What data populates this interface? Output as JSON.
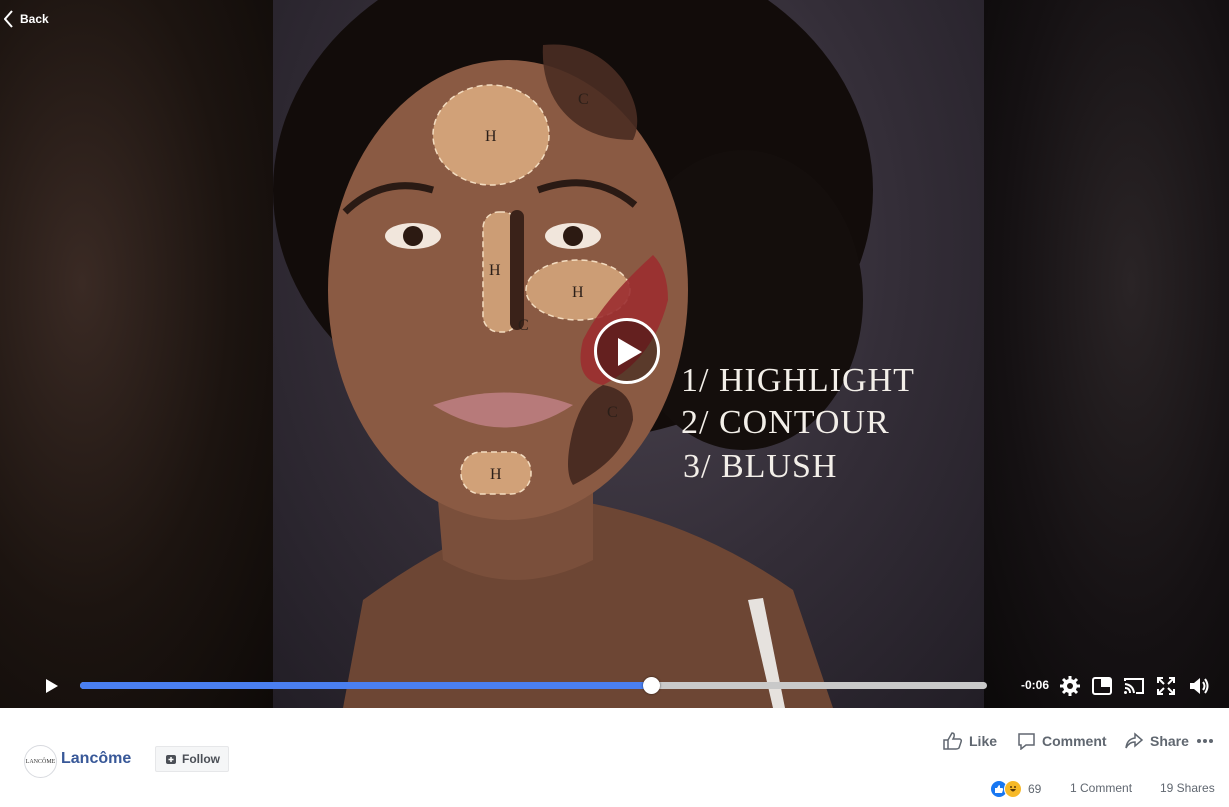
{
  "nav": {
    "back_label": "Back"
  },
  "video": {
    "overlay_labels": {
      "highlight": "H",
      "contour": "C"
    },
    "caption_lines": [
      "1/ HIGHLIGHT",
      "2/ CONTOUR",
      "3/ BLUSH"
    ],
    "time_remaining": "-0:06",
    "progress": 0.63
  },
  "post": {
    "page_name": "Lancôme",
    "avatar_text": "LANCÔME",
    "follow_label": "Follow",
    "actions": {
      "like": "Like",
      "comment": "Comment",
      "share": "Share"
    },
    "reaction_count": "69",
    "comments_text": "1 Comment",
    "shares_text": "19 Shares"
  },
  "colors": {
    "accent": "#4a7ff0",
    "link": "#385898",
    "like_blue": "#1877f2",
    "haha_yellow": "#f7b928"
  }
}
